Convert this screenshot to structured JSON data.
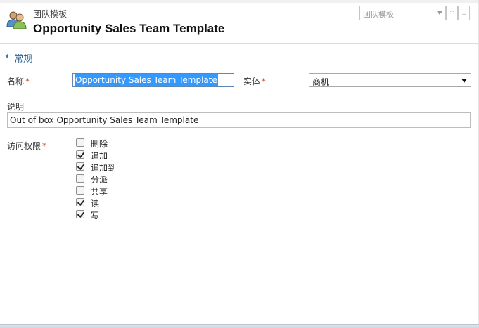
{
  "header": {
    "entity_type": "团队模板",
    "record_title": "Opportunity Sales Team Template",
    "form_selector": "团队模板",
    "nav_up": "🡑",
    "nav_down": "🡓"
  },
  "section": {
    "title": "常规"
  },
  "fields": {
    "name": {
      "label": "名称",
      "required_mark": "*",
      "value": "Opportunity Sales Team Template"
    },
    "entity": {
      "label": "实体",
      "required_mark": "*",
      "value": "商机"
    },
    "description": {
      "label": "说明",
      "value": "Out of box Opportunity Sales Team Template"
    },
    "access": {
      "label": "访问权限",
      "required_mark": "*",
      "options": [
        {
          "label": "删除",
          "checked": false
        },
        {
          "label": "追加",
          "checked": true
        },
        {
          "label": "追加到",
          "checked": true
        },
        {
          "label": "分派",
          "checked": false
        },
        {
          "label": "共享",
          "checked": false
        },
        {
          "label": "读",
          "checked": true
        },
        {
          "label": "写",
          "checked": true
        }
      ]
    }
  },
  "colors": {
    "accent": "#2b6496",
    "required": "#c0392b",
    "selection": "#3399ff"
  }
}
